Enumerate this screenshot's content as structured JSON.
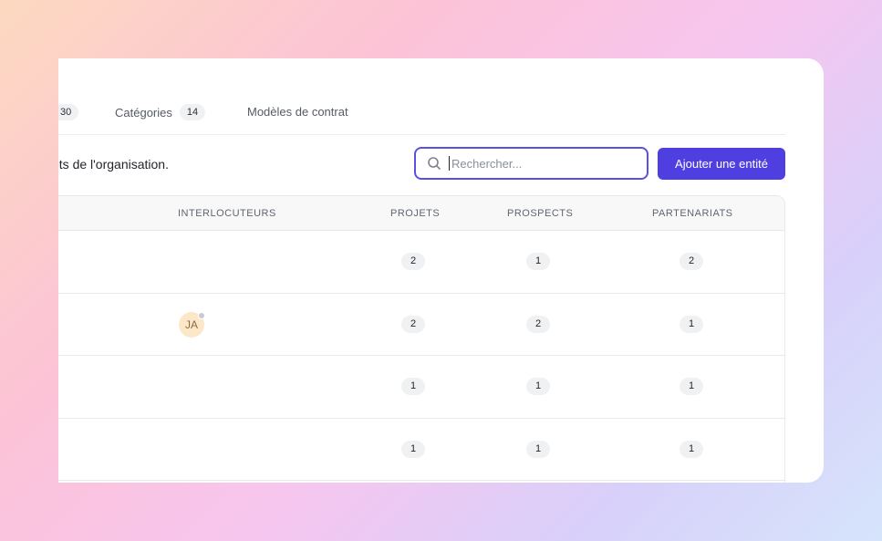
{
  "tabs": [
    {
      "label": "",
      "count": "30"
    },
    {
      "label": "Catégories",
      "count": "14"
    },
    {
      "label": "Modèles de contrat",
      "count": ""
    }
  ],
  "description": "ets de l'organisation.",
  "search": {
    "placeholder": "Rechercher..."
  },
  "add_button": "Ajouter une entité",
  "table": {
    "headers": [
      "INTERLOCUTEURS",
      "PROJETS",
      "PROSPECTS",
      "PARTENARIATS"
    ],
    "rows": [
      {
        "avatar": "",
        "projets": "2",
        "prospects": "1",
        "partenariats": "2"
      },
      {
        "avatar": "JA",
        "projets": "2",
        "prospects": "2",
        "partenariats": "1"
      },
      {
        "avatar": "",
        "projets": "1",
        "prospects": "1",
        "partenariats": "1"
      },
      {
        "avatar": "",
        "projets": "1",
        "prospects": "1",
        "partenariats": "1"
      }
    ]
  },
  "colors": {
    "accent": "#4f3fe0",
    "focus_border": "#5b50e0"
  }
}
